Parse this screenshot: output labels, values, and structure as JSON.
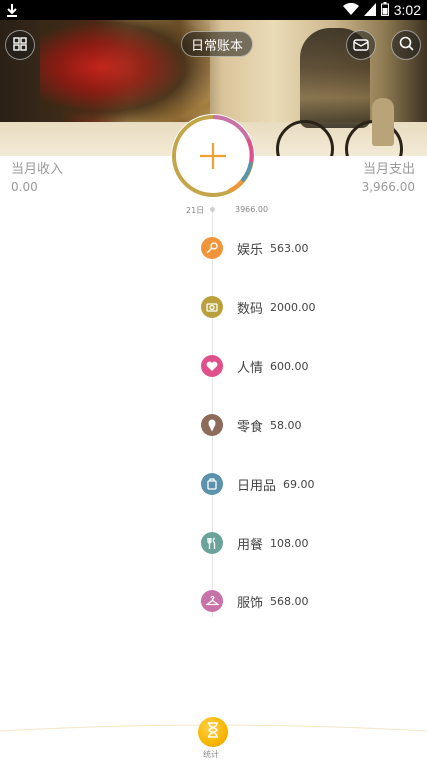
{
  "status_bar": {
    "time": "3:02"
  },
  "header": {
    "book_name": "日常账本"
  },
  "summary": {
    "income_label": "当月收入",
    "income_value": "0.00",
    "expense_label": "当月支出",
    "expense_value": "3,966.00"
  },
  "timeline": {
    "day_label": "21日",
    "day_total": "3966.00",
    "entries": [
      {
        "name": "娱乐",
        "amount": "563.00",
        "icon": "microphone-icon",
        "color": "#f0953a"
      },
      {
        "name": "数码",
        "amount": "2000.00",
        "icon": "camera-icon",
        "color": "#b8a13c"
      },
      {
        "name": "人情",
        "amount": "600.00",
        "icon": "heart-icon",
        "color": "#e0508a"
      },
      {
        "name": "零食",
        "amount": "58.00",
        "icon": "ice-cream-icon",
        "color": "#8e6a5a"
      },
      {
        "name": "日用品",
        "amount": "69.00",
        "icon": "daily-goods-icon",
        "color": "#5a93aa"
      },
      {
        "name": "用餐",
        "amount": "108.00",
        "icon": "fork-knife-icon",
        "color": "#6aa39a"
      },
      {
        "name": "服饰",
        "amount": "568.00",
        "icon": "hanger-icon",
        "color": "#c772a8"
      }
    ]
  },
  "bottom": {
    "stats_label": "统计"
  },
  "colors": {
    "accent": "#f0a030",
    "ring": "#c4a64a"
  }
}
